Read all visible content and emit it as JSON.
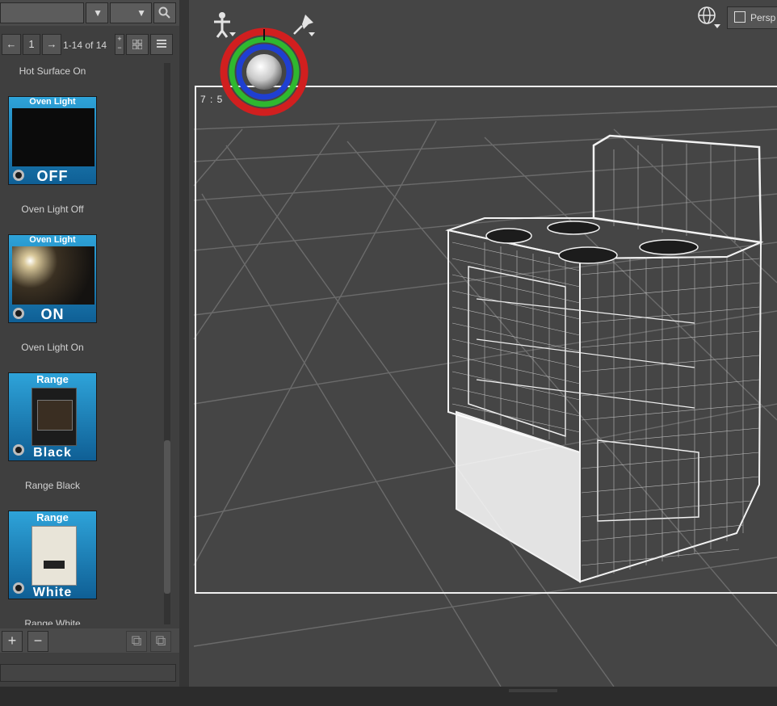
{
  "left_panel": {
    "pager": {
      "prev": "←",
      "page": "1",
      "next": "→",
      "range": "1-14 of 14",
      "grid_icon": "grid-view-icon",
      "list_icon": "list-view-icon"
    },
    "items": [
      {
        "label": "Hot Surface On"
      },
      {
        "label": "Oven Light Off",
        "thumb_title": "Oven Light",
        "thumb_text": "OFF"
      },
      {
        "label": "Oven Light On",
        "thumb_title": "Oven Light",
        "thumb_text": "ON"
      },
      {
        "label": "Range Black",
        "thumb_title": "Range",
        "thumb_text": "Black"
      },
      {
        "label": "Range White",
        "thumb_title": "Range",
        "thumb_text": "White"
      }
    ],
    "bottom": {
      "add": "+",
      "remove": "−"
    }
  },
  "viewport": {
    "camera_button": "Persp",
    "frame_label": "7 : 5",
    "icons": [
      "figure-select-icon",
      "pin-icon",
      "globe-icon",
      "camera-rotate-gizmo"
    ]
  },
  "colors": {
    "accent_blue": "#1e84c7",
    "gizmo_red": "#d11f1f",
    "gizmo_green": "#2fb82f",
    "gizmo_blue": "#1f3fd1"
  }
}
